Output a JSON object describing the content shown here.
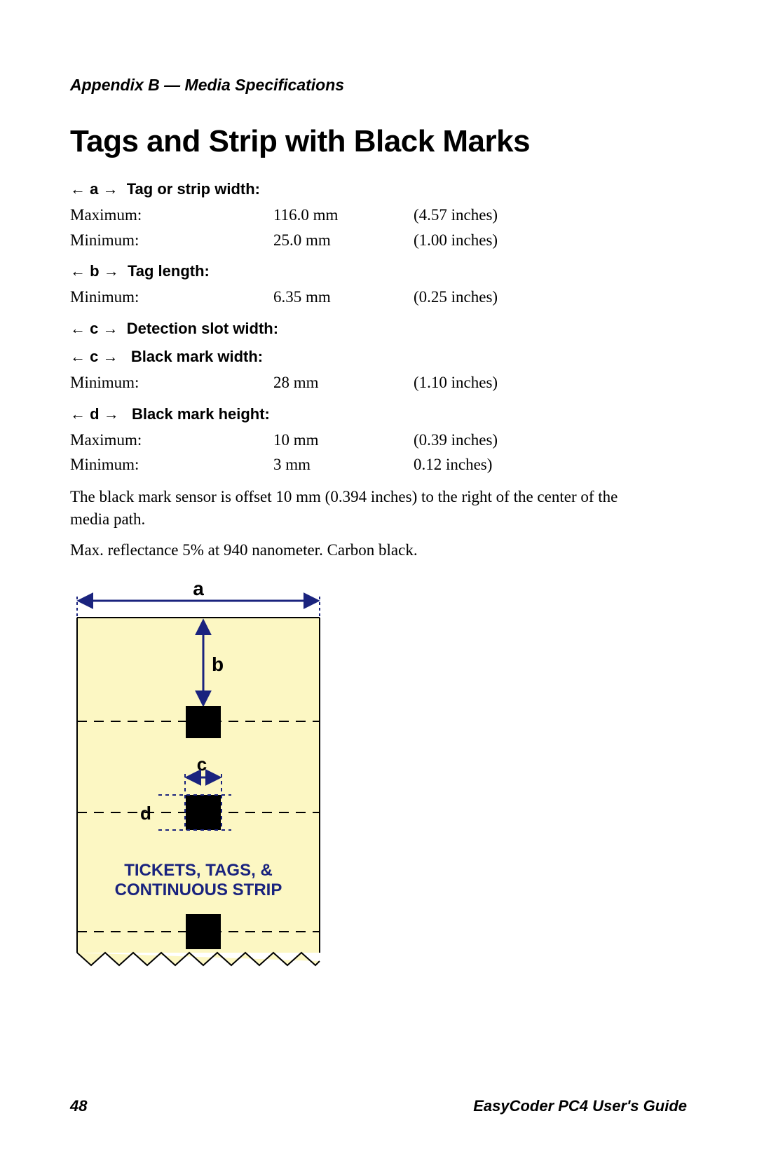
{
  "appendix": "Appendix B — Media Specifications",
  "title": "Tags and Strip with Black Marks",
  "sections": {
    "a": {
      "label_sym_l": "←",
      "label_letter": "a",
      "label_sym_r": "→",
      "label_text": "Tag or strip width:",
      "rows": [
        {
          "k": "Maximum:",
          "mm": "116.0 mm",
          "in": "(4.57 inches)"
        },
        {
          "k": "Minimum:",
          "mm": "25.0 mm",
          "in": "(1.00 inches)"
        }
      ]
    },
    "b": {
      "label_sym_l": "←",
      "label_letter": "b",
      "label_sym_r": "→",
      "label_text": "Tag length:",
      "rows": [
        {
          "k": "Minimum:",
          "mm": "6.35 mm",
          "in": "(0.25 inches)"
        }
      ]
    },
    "c1": {
      "label_sym_l": "←",
      "label_letter": "c",
      "label_sym_r": "→",
      "label_text": "Detection slot width:"
    },
    "c2": {
      "label_sym_l": "←",
      "label_letter": "c",
      "label_sym_r": "→",
      "label_text": "Black mark width:",
      "rows": [
        {
          "k": "Minimum:",
          "mm": "28 mm",
          "in": "(1.10 inches)"
        }
      ]
    },
    "d": {
      "label_sym_l": "←",
      "label_letter": "d",
      "label_sym_r": "→",
      "label_text": "Black mark height:",
      "rows": [
        {
          "k": "Maximum:",
          "mm": "10 mm",
          "in": "(0.39 inches)"
        },
        {
          "k": "Minimum:",
          "mm": "3 mm",
          "in": "0.12 inches)"
        }
      ]
    }
  },
  "note1": "The black mark sensor is offset 10 mm (0.394 inches) to the right of the center of the media path.",
  "note2": "Max. reflectance 5% at 940 nanometer. Carbon black.",
  "diagram": {
    "a": "a",
    "b": "b",
    "c": "c",
    "d": "d",
    "caption_l1": "TICKETS, TAGS, &",
    "caption_l2": "CONTINUOUS STRIP"
  },
  "footer": {
    "page": "48",
    "guide": "EasyCoder PC4 User's Guide"
  }
}
